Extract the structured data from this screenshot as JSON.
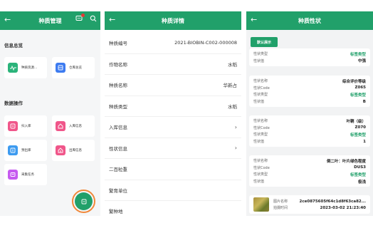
{
  "screen1": {
    "title": "种质管理",
    "back_icon": "arrow-left-icon",
    "badge_color": "#e53935",
    "section_info": "信息总览",
    "section_ops": "数据操作",
    "tiles": [
      {
        "label": "种质资源...",
        "color": "#2bb37a"
      },
      {
        "label": "仓库总览",
        "color": "#3d7bf0"
      },
      {
        "label": "扫入库",
        "color": "#f0568a"
      },
      {
        "label": "入库信息",
        "color": "#f0568a"
      },
      {
        "label": "预出库",
        "color": "#3d9bf0"
      },
      {
        "label": "出库信息",
        "color": "#f0568a"
      },
      {
        "label": "采集任务",
        "color": "#c65af0"
      }
    ]
  },
  "screen2": {
    "title": "种质详情",
    "rows": [
      {
        "key": "种质编号",
        "value": "2021-BIOBIN-C002-000008"
      },
      {
        "key": "作物名称",
        "value": "水稻"
      },
      {
        "key": "种质名称",
        "value": "华新占"
      },
      {
        "key": "种质类型",
        "value": "水稻"
      },
      {
        "key": "入库信息",
        "value": "›"
      },
      {
        "key": "性状信息",
        "value": "›"
      },
      {
        "key": "二百粒重",
        "value": ""
      },
      {
        "key": "繁育单位",
        "value": ""
      },
      {
        "key": "繁种地",
        "value": ""
      }
    ]
  },
  "screen3": {
    "title": "种质性状",
    "default_button": "默认展示",
    "card0": [
      {
        "k": "性状类型",
        "v": "标签类型",
        "green": true
      },
      {
        "k": "性状值",
        "v": "中强",
        "green": false
      }
    ],
    "card1": [
      {
        "k": "性状名称",
        "v": "综合评价等级",
        "green": false
      },
      {
        "k": "性状Code",
        "v": "Z065",
        "green": false
      },
      {
        "k": "性状类型",
        "v": "标签类型",
        "green": true
      },
      {
        "k": "性状值",
        "v": "B",
        "green": false
      }
    ],
    "card2": [
      {
        "k": "性状名称",
        "v": "叶鞘（级）",
        "green": false
      },
      {
        "k": "性状Code",
        "v": "Z070",
        "green": false
      },
      {
        "k": "性状类型",
        "v": "标签类型",
        "green": true
      },
      {
        "k": "性状值",
        "v": "1",
        "green": false
      }
    ],
    "card3": [
      {
        "k": "性状名称",
        "v": "倒二叶：叶片绿色程度",
        "green": false
      },
      {
        "k": "性状Code",
        "v": "DUS3",
        "green": false
      },
      {
        "k": "性状类型",
        "v": "标签类型",
        "green": true
      },
      {
        "k": "性状值",
        "v": "极浅",
        "green": false
      }
    ],
    "picture": {
      "name_label": "图片名称",
      "name_value": "2ce0875605f64c1d8f63ca82...",
      "time_label": "拍摄时间",
      "time_value": "2023-03-02 21:23:40"
    }
  }
}
